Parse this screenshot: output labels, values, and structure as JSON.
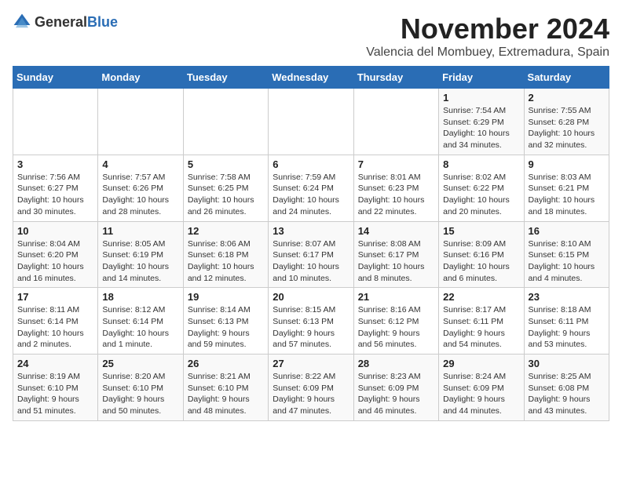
{
  "header": {
    "logo_general": "General",
    "logo_blue": "Blue",
    "month": "November 2024",
    "location": "Valencia del Mombuey, Extremadura, Spain"
  },
  "days_of_week": [
    "Sunday",
    "Monday",
    "Tuesday",
    "Wednesday",
    "Thursday",
    "Friday",
    "Saturday"
  ],
  "weeks": [
    [
      {
        "day": "",
        "info": ""
      },
      {
        "day": "",
        "info": ""
      },
      {
        "day": "",
        "info": ""
      },
      {
        "day": "",
        "info": ""
      },
      {
        "day": "",
        "info": ""
      },
      {
        "day": "1",
        "info": "Sunrise: 7:54 AM\nSunset: 6:29 PM\nDaylight: 10 hours and 34 minutes."
      },
      {
        "day": "2",
        "info": "Sunrise: 7:55 AM\nSunset: 6:28 PM\nDaylight: 10 hours and 32 minutes."
      }
    ],
    [
      {
        "day": "3",
        "info": "Sunrise: 7:56 AM\nSunset: 6:27 PM\nDaylight: 10 hours and 30 minutes."
      },
      {
        "day": "4",
        "info": "Sunrise: 7:57 AM\nSunset: 6:26 PM\nDaylight: 10 hours and 28 minutes."
      },
      {
        "day": "5",
        "info": "Sunrise: 7:58 AM\nSunset: 6:25 PM\nDaylight: 10 hours and 26 minutes."
      },
      {
        "day": "6",
        "info": "Sunrise: 7:59 AM\nSunset: 6:24 PM\nDaylight: 10 hours and 24 minutes."
      },
      {
        "day": "7",
        "info": "Sunrise: 8:01 AM\nSunset: 6:23 PM\nDaylight: 10 hours and 22 minutes."
      },
      {
        "day": "8",
        "info": "Sunrise: 8:02 AM\nSunset: 6:22 PM\nDaylight: 10 hours and 20 minutes."
      },
      {
        "day": "9",
        "info": "Sunrise: 8:03 AM\nSunset: 6:21 PM\nDaylight: 10 hours and 18 minutes."
      }
    ],
    [
      {
        "day": "10",
        "info": "Sunrise: 8:04 AM\nSunset: 6:20 PM\nDaylight: 10 hours and 16 minutes."
      },
      {
        "day": "11",
        "info": "Sunrise: 8:05 AM\nSunset: 6:19 PM\nDaylight: 10 hours and 14 minutes."
      },
      {
        "day": "12",
        "info": "Sunrise: 8:06 AM\nSunset: 6:18 PM\nDaylight: 10 hours and 12 minutes."
      },
      {
        "day": "13",
        "info": "Sunrise: 8:07 AM\nSunset: 6:17 PM\nDaylight: 10 hours and 10 minutes."
      },
      {
        "day": "14",
        "info": "Sunrise: 8:08 AM\nSunset: 6:17 PM\nDaylight: 10 hours and 8 minutes."
      },
      {
        "day": "15",
        "info": "Sunrise: 8:09 AM\nSunset: 6:16 PM\nDaylight: 10 hours and 6 minutes."
      },
      {
        "day": "16",
        "info": "Sunrise: 8:10 AM\nSunset: 6:15 PM\nDaylight: 10 hours and 4 minutes."
      }
    ],
    [
      {
        "day": "17",
        "info": "Sunrise: 8:11 AM\nSunset: 6:14 PM\nDaylight: 10 hours and 2 minutes."
      },
      {
        "day": "18",
        "info": "Sunrise: 8:12 AM\nSunset: 6:14 PM\nDaylight: 10 hours and 1 minute."
      },
      {
        "day": "19",
        "info": "Sunrise: 8:14 AM\nSunset: 6:13 PM\nDaylight: 9 hours and 59 minutes."
      },
      {
        "day": "20",
        "info": "Sunrise: 8:15 AM\nSunset: 6:13 PM\nDaylight: 9 hours and 57 minutes."
      },
      {
        "day": "21",
        "info": "Sunrise: 8:16 AM\nSunset: 6:12 PM\nDaylight: 9 hours and 56 minutes."
      },
      {
        "day": "22",
        "info": "Sunrise: 8:17 AM\nSunset: 6:11 PM\nDaylight: 9 hours and 54 minutes."
      },
      {
        "day": "23",
        "info": "Sunrise: 8:18 AM\nSunset: 6:11 PM\nDaylight: 9 hours and 53 minutes."
      }
    ],
    [
      {
        "day": "24",
        "info": "Sunrise: 8:19 AM\nSunset: 6:10 PM\nDaylight: 9 hours and 51 minutes."
      },
      {
        "day": "25",
        "info": "Sunrise: 8:20 AM\nSunset: 6:10 PM\nDaylight: 9 hours and 50 minutes."
      },
      {
        "day": "26",
        "info": "Sunrise: 8:21 AM\nSunset: 6:10 PM\nDaylight: 9 hours and 48 minutes."
      },
      {
        "day": "27",
        "info": "Sunrise: 8:22 AM\nSunset: 6:09 PM\nDaylight: 9 hours and 47 minutes."
      },
      {
        "day": "28",
        "info": "Sunrise: 8:23 AM\nSunset: 6:09 PM\nDaylight: 9 hours and 46 minutes."
      },
      {
        "day": "29",
        "info": "Sunrise: 8:24 AM\nSunset: 6:09 PM\nDaylight: 9 hours and 44 minutes."
      },
      {
        "day": "30",
        "info": "Sunrise: 8:25 AM\nSunset: 6:08 PM\nDaylight: 9 hours and 43 minutes."
      }
    ]
  ]
}
